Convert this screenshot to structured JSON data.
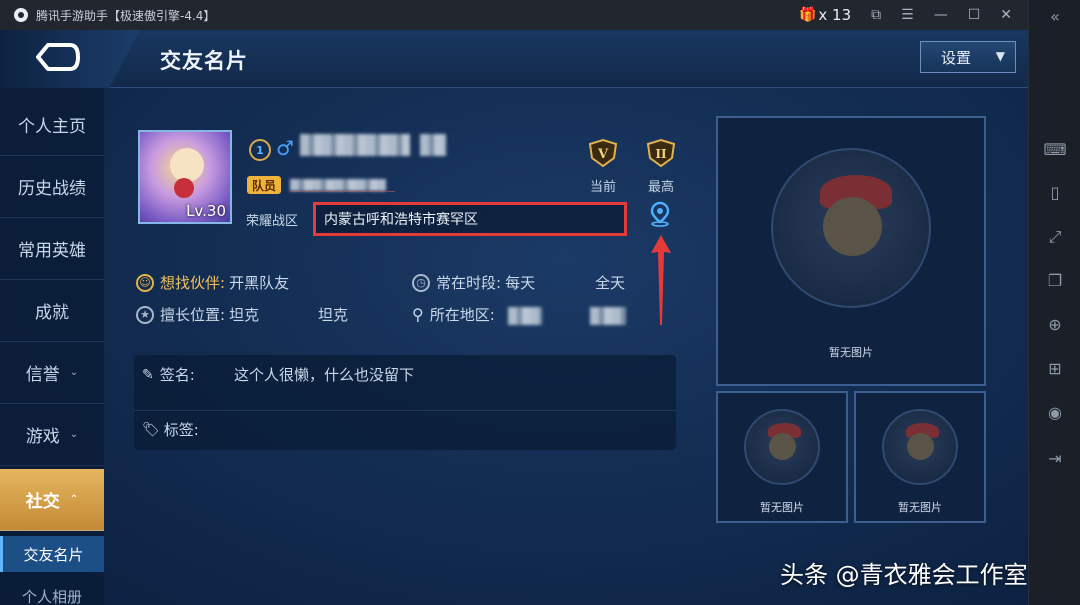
{
  "window": {
    "title": "腾讯手游助手【极速傲引擎-4.4】",
    "gift_count": "x 13"
  },
  "header": {
    "title": "交友名片",
    "settings_label": "设置"
  },
  "sidebar": {
    "items": [
      {
        "label": "个人主页"
      },
      {
        "label": "历史战绩"
      },
      {
        "label": "常用英雄"
      },
      {
        "label": "成就"
      },
      {
        "label": "信誉"
      },
      {
        "label": "游戏"
      },
      {
        "label": "社交"
      }
    ],
    "sub_items": [
      {
        "label": "交友名片"
      },
      {
        "label": "个人相册"
      }
    ]
  },
  "profile": {
    "level": "Lv.30",
    "rank_badge": "1",
    "team_tag": "队员",
    "region_label": "荣耀战区",
    "region_value": "内蒙古呼和浩特市赛罕区",
    "rank_current_label": "当前",
    "rank_best_label": "最高",
    "rank_current": "V",
    "rank_best": "II"
  },
  "details": {
    "partner_label": "想找伙伴:",
    "partner_value": "开黑队友",
    "time_label": "常在时段:",
    "time_value": "每天",
    "time_extra": "全天",
    "position_label": "擅长位置:",
    "position_value": "坦克",
    "position_extra": "坦克",
    "area_label": "所在地区:"
  },
  "signature": {
    "sign_label": "签名:",
    "sign_value": "这个人很懒，什么也没留下",
    "tags_label": "标签:"
  },
  "gallery": {
    "no_image": "暂无图片"
  },
  "watermark": "头条 @青衣雅会工作室",
  "colors": {
    "highlight_red": "#e43a3a",
    "nav_active": "#e5b65f",
    "accent_blue": "#46a3ff"
  }
}
